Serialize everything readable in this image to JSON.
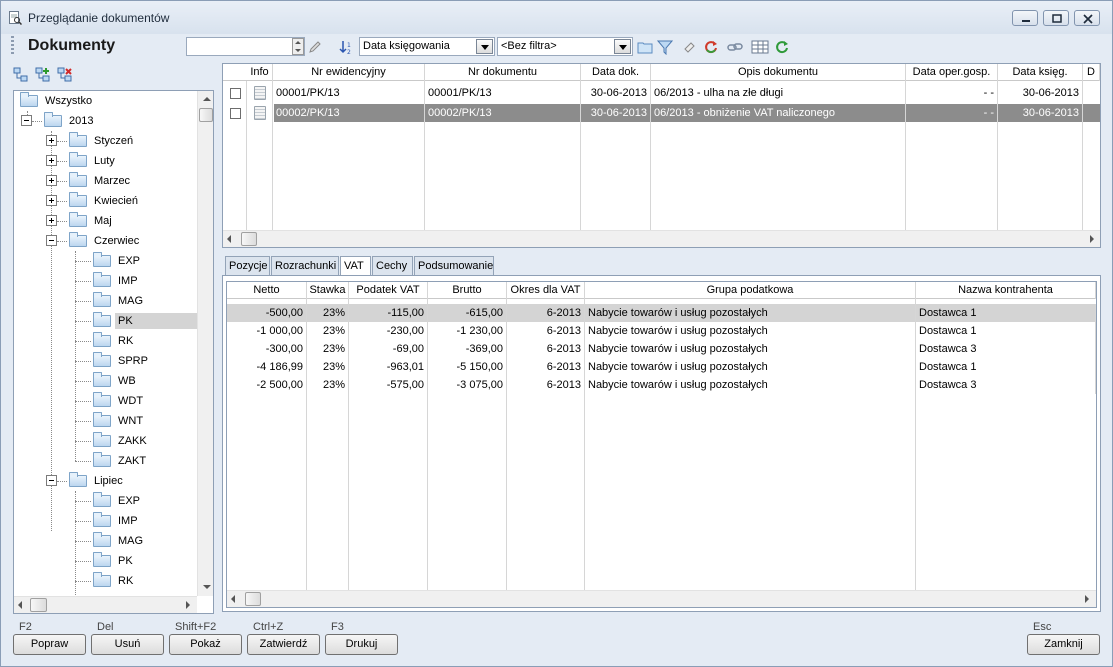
{
  "window": {
    "title": "Przeglądanie dokumentów"
  },
  "toolbar": {
    "app_title": "Dokumenty",
    "search_value": "",
    "sort_field": "Data księgowania",
    "filter_value": "<Bez filtra>"
  },
  "tree": {
    "root": "Wszystko",
    "year": "2013",
    "months": [
      "Styczeń",
      "Luty",
      "Marzec",
      "Kwiecień",
      "Maj"
    ],
    "june": "Czerwiec",
    "june_children": [
      "EXP",
      "IMP",
      "MAG",
      "PK",
      "RK",
      "SPRP",
      "WB",
      "WDT",
      "WNT",
      "ZAKK",
      "ZAKT"
    ],
    "july": "Lipiec",
    "july_children": [
      "EXP",
      "IMP",
      "MAG",
      "PK",
      "RK"
    ],
    "selected": "PK"
  },
  "documents": {
    "headers": [
      "Info",
      "Nr ewidencyjny",
      "Nr dokumentu",
      "Data dok.",
      "Opis dokumentu",
      "Data oper.gosp.",
      "Data księg.",
      "D"
    ],
    "rows": [
      {
        "nr_ew": "00001/PK/13",
        "nr_dok": "00001/PK/13",
        "data_dok": "30-06-2013",
        "opis": "06/2013 - ulha na złe długi",
        "data_oper": "- -",
        "data_ksieg": "30-06-2013"
      },
      {
        "nr_ew": "00002/PK/13",
        "nr_dok": "00002/PK/13",
        "data_dok": "30-06-2013",
        "opis": "06/2013 - obniżenie VAT naliczonego",
        "data_oper": "- -",
        "data_ksieg": "30-06-2013"
      }
    ]
  },
  "tabs": [
    "Pozycje",
    "Rozrachunki",
    "VAT",
    "Cechy",
    "Podsumowanie"
  ],
  "active_tab": "VAT",
  "vat": {
    "headers": [
      "Netto",
      "Stawka",
      "Podatek VAT",
      "Brutto",
      "Okres dla VAT",
      "Grupa podatkowa",
      "Nazwa kontrahenta"
    ],
    "rows": [
      {
        "netto": "-500,00",
        "stawka": "23%",
        "vat": "-115,00",
        "brutto": "-615,00",
        "okres": "6-2013",
        "grupa": "Nabycie towarów i usług pozostałych",
        "kontrahent": "Dostawca 1"
      },
      {
        "netto": "-1 000,00",
        "stawka": "23%",
        "vat": "-230,00",
        "brutto": "-1 230,00",
        "okres": "6-2013",
        "grupa": "Nabycie towarów i usług pozostałych",
        "kontrahent": "Dostawca 1"
      },
      {
        "netto": "-300,00",
        "stawka": "23%",
        "vat": "-69,00",
        "brutto": "-369,00",
        "okres": "6-2013",
        "grupa": "Nabycie towarów i usług pozostałych",
        "kontrahent": "Dostawca 3"
      },
      {
        "netto": "-4 186,99",
        "stawka": "23%",
        "vat": "-963,01",
        "brutto": "-5 150,00",
        "okres": "6-2013",
        "grupa": "Nabycie towarów i usług pozostałych",
        "kontrahent": "Dostawca 1"
      },
      {
        "netto": "-2 500,00",
        "stawka": "23%",
        "vat": "-575,00",
        "brutto": "-3 075,00",
        "okres": "6-2013",
        "grupa": "Nabycie towarów i usług pozostałych",
        "kontrahent": "Dostawca 3"
      }
    ]
  },
  "buttons": [
    {
      "key": "F2",
      "label": "Popraw"
    },
    {
      "key": "Del",
      "label": "Usuń"
    },
    {
      "key": "Shift+F2",
      "label": "Pokaż"
    },
    {
      "key": "Ctrl+Z",
      "label": "Zatwierdź"
    },
    {
      "key": "F3",
      "label": "Drukuj"
    }
  ],
  "close_button": {
    "key": "Esc",
    "label": "Zamknij"
  },
  "colors": {
    "selected_row": "#8c8c8c",
    "tree_selected": "#d4d4d4",
    "window_bg": "#e4ebf4"
  }
}
